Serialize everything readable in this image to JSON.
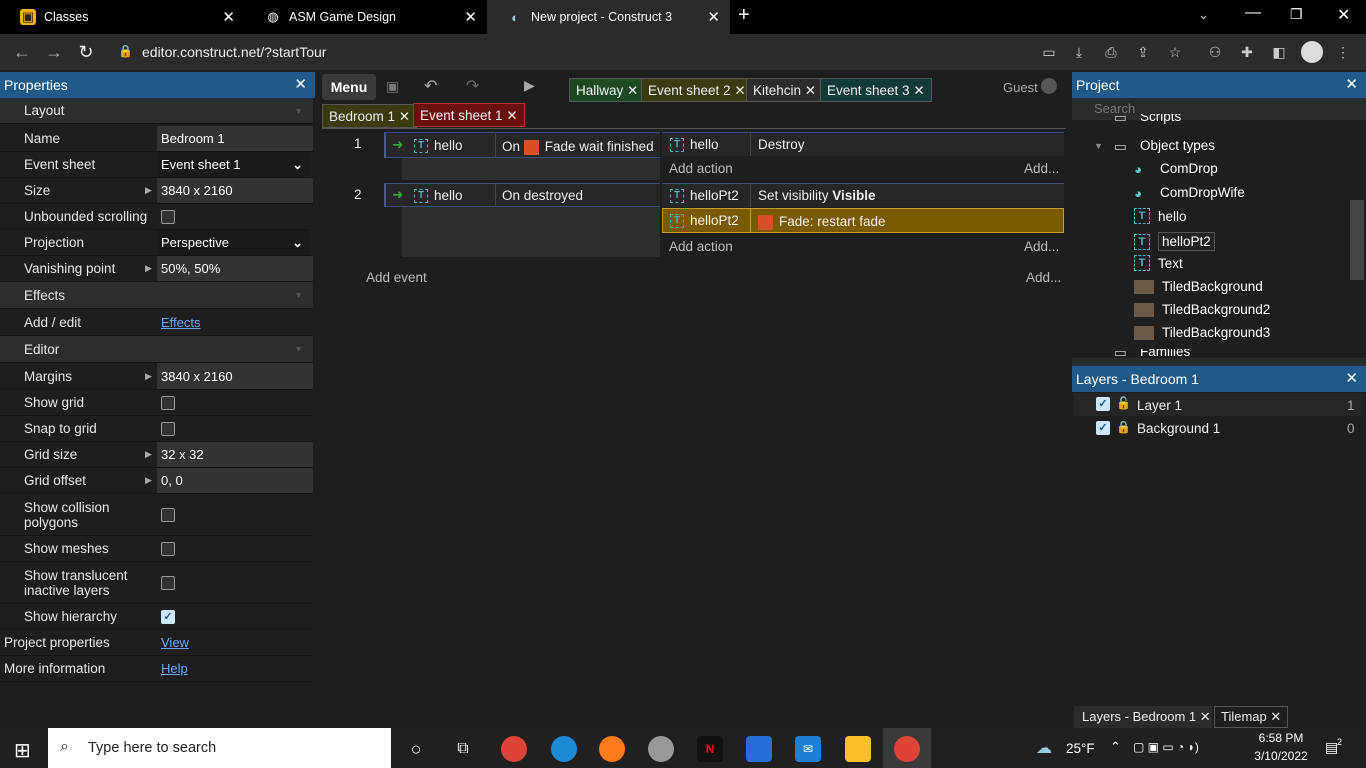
{
  "browser": {
    "tabs": [
      {
        "label": "Classes",
        "icon": "classes-icon"
      },
      {
        "label": "ASM Game Design",
        "icon": "globe-icon"
      },
      {
        "label": "New project - Construct 3",
        "icon": "construct-icon"
      }
    ],
    "url": "editor.construct.net/?startTour"
  },
  "properties": {
    "title": "Properties",
    "layout_section": "Layout",
    "name_label": "Name",
    "name_value": "Bedroom 1",
    "event_sheet_label": "Event sheet",
    "event_sheet_value": "Event sheet 1",
    "size_label": "Size",
    "size_value": "3840 x 2160",
    "unbounded_label": "Unbounded scrolling",
    "projection_label": "Projection",
    "projection_value": "Perspective",
    "vanishing_label": "Vanishing point",
    "vanishing_value": "50%, 50%",
    "effects_section": "Effects",
    "add_edit_label": "Add / edit",
    "add_edit_link": "Effects",
    "editor_section": "Editor",
    "margins_label": "Margins",
    "margins_value": "3840 x 2160",
    "show_grid_label": "Show grid",
    "snap_label": "Snap to grid",
    "grid_size_label": "Grid size",
    "grid_size_value": "32 x 32",
    "grid_offset_label": "Grid offset",
    "grid_offset_value": "0, 0",
    "collision_label_1": "Show collision",
    "collision_label_2": "polygons",
    "meshes_label": "Show meshes",
    "translucent_label_1": "Show translucent",
    "translucent_label_2": "inactive layers",
    "hierarchy_label": "Show hierarchy",
    "project_props_label": "Project properties",
    "project_props_link": "View",
    "more_info_label": "More information",
    "more_info_link": "Help"
  },
  "editor": {
    "menu": "Menu",
    "guest": "Guest",
    "top_tabs": [
      "Hallway",
      "Event sheet 2",
      "Kitehcin",
      "Event sheet 3"
    ],
    "sub_tabs": [
      "Bedroom 1",
      "Event sheet 1"
    ],
    "events": [
      {
        "num": "1",
        "object": "hello",
        "condition_prefix": "On",
        "condition": "Fade wait finished",
        "actions": [
          {
            "object": "hello",
            "text": "Destroy",
            "bold": ""
          }
        ]
      },
      {
        "num": "2",
        "object": "hello",
        "condition_prefix": "",
        "condition": "On destroyed",
        "actions": [
          {
            "object": "helloPt2",
            "text": "Set visibility ",
            "bold": "Visible"
          },
          {
            "object": "helloPt2",
            "text": "Fade: restart fade",
            "bold": ""
          }
        ]
      }
    ],
    "add_action": "Add action",
    "add_more": "Add...",
    "add_event": "Add event"
  },
  "project": {
    "title": "Project",
    "search_placeholder": "Search",
    "items": [
      "Scripts",
      "Object types",
      "ComDrop",
      "ComDropWife",
      "hello",
      "helloPt2",
      "Text",
      "TiledBackground",
      "TiledBackground2",
      "TiledBackground3",
      "Families"
    ]
  },
  "layers": {
    "title": "Layers - Bedroom 1",
    "items": [
      {
        "name": "Layer 1",
        "num": "1"
      },
      {
        "name": "Background 1",
        "num": "0"
      }
    ],
    "bottom_tabs": [
      "Layers - Bedroom 1",
      "Tilemap"
    ]
  },
  "taskbar": {
    "search": "Type here to search",
    "weather": "25°F",
    "time": "6:58 PM",
    "date": "3/10/2022",
    "notif": "2"
  },
  "colors": {
    "panel_header": "#1f5a8a",
    "event_highlight": "#7a5a00",
    "accent": "#1f5a8a"
  }
}
